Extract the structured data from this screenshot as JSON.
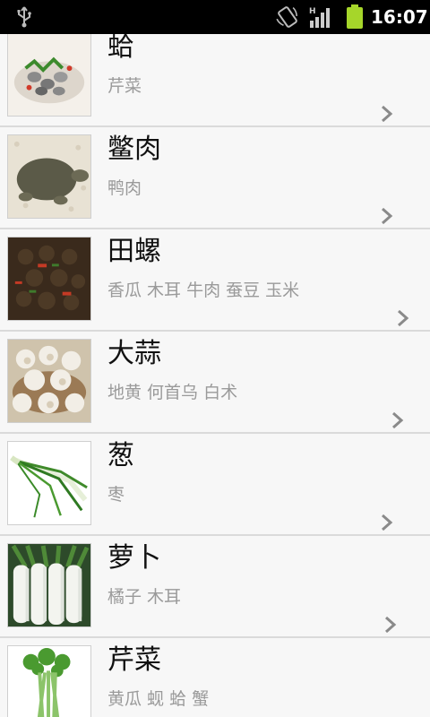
{
  "status_bar": {
    "time": "16:07",
    "icons": [
      "usb-icon",
      "screen-rotation-icon",
      "signal-h-icon",
      "battery-icon"
    ]
  },
  "items": [
    {
      "title": "蛤",
      "subtitle": "芹菜",
      "image": "clam-dish-image"
    },
    {
      "title": "鳖肉",
      "subtitle": "鸭肉",
      "image": "softshell-turtle-image"
    },
    {
      "title": "田螺",
      "subtitle": "香瓜 木耳 牛肉 蚕豆 玉米",
      "image": "river-snail-image"
    },
    {
      "title": "大蒜",
      "subtitle": "地黄 何首乌 白术",
      "image": "garlic-image"
    },
    {
      "title": "葱",
      "subtitle": "枣",
      "image": "scallion-image"
    },
    {
      "title": "萝卜",
      "subtitle": "橘子 木耳",
      "image": "radish-image"
    },
    {
      "title": "芹菜",
      "subtitle": "黄瓜 蚬 蛤 蟹",
      "image": "celery-image"
    }
  ],
  "colors": {
    "statusbar_bg": "#000000",
    "battery": "#a6d62a",
    "row_bg": "#f7f7f7",
    "divider": "#dadada",
    "subtitle": "#9a9a9a"
  }
}
